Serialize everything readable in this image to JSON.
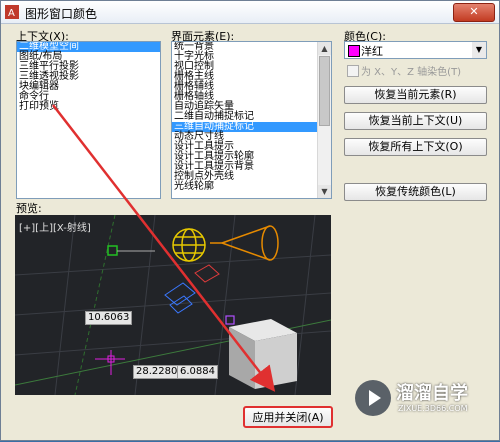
{
  "window": {
    "title": "图形窗口颜色",
    "close": "✕"
  },
  "context": {
    "label": "上下文(X):",
    "items": [
      {
        "label": "二维模型空间",
        "selected": true
      },
      {
        "label": "图纸/布局",
        "selected": false
      },
      {
        "label": "三维平行投影",
        "selected": false
      },
      {
        "label": "三维透视投影",
        "selected": false
      },
      {
        "label": "块编辑器",
        "selected": false
      },
      {
        "label": "命令行",
        "selected": false
      },
      {
        "label": "打印预览",
        "selected": false
      }
    ]
  },
  "elements": {
    "label": "界面元素(E):",
    "items": [
      {
        "label": "统一背景",
        "selected": false
      },
      {
        "label": "十字光标",
        "selected": false
      },
      {
        "label": "视口控制",
        "selected": false
      },
      {
        "label": "栅格主线",
        "selected": false
      },
      {
        "label": "栅格辅线",
        "selected": false
      },
      {
        "label": "栅格轴线",
        "selected": false
      },
      {
        "label": "自动追踪矢量",
        "selected": false
      },
      {
        "label": "二维自动捕捉标记",
        "selected": false
      },
      {
        "label": "三维自动捕捉标记",
        "selected": true
      },
      {
        "label": "动态尺寸线",
        "selected": false
      },
      {
        "label": "设计工具提示",
        "selected": false
      },
      {
        "label": "设计工具提示轮廓",
        "selected": false
      },
      {
        "label": "设计工具提示背景",
        "selected": false
      },
      {
        "label": "控制点外壳线",
        "selected": false
      },
      {
        "label": "光线轮廓",
        "selected": false
      }
    ]
  },
  "color": {
    "label": "颜色(C):",
    "value": "洋红",
    "swatch": "#ff00ff",
    "tint_label": "为 X、Y、Z 轴染色(T)"
  },
  "buttons": {
    "restore_element": "恢复当前元素(R)",
    "restore_context": "恢复当前上下文(U)",
    "restore_all": "恢复所有上下文(O)",
    "restore_classic": "恢复传统颜色(L)",
    "apply_close": "应用并关闭(A)"
  },
  "preview": {
    "label": "预览:",
    "viewport_label": "[+][上][X-射线]",
    "coord1": "10.6063",
    "coord2": "28.2280",
    "coord3": "6.0884"
  },
  "watermark": {
    "name": "溜溜自学",
    "url": "ZIXUE.3D66.COM"
  }
}
